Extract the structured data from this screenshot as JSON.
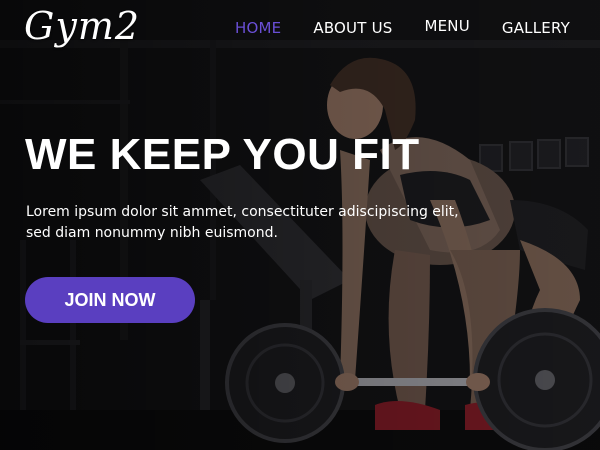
{
  "brand": {
    "logo_text": "Gym2"
  },
  "nav": {
    "items": [
      {
        "label": "HOME",
        "active": true
      },
      {
        "label": "ABOUT US",
        "active": false
      },
      {
        "label": "MENU",
        "active": false
      },
      {
        "label": "GALLERY",
        "active": false
      }
    ]
  },
  "hero": {
    "headline": "WE KEEP YOU FIT",
    "subtext": "Lorem ipsum dolor sit ammet, consectituter adiscipiscing elit, sed diam nonummy nibh euismond.",
    "cta_label": "JOIN NOW"
  },
  "colors": {
    "accent": "#5a3fc0",
    "nav_active": "#6a4fd6",
    "text": "#ffffff",
    "background": "#0e0e10"
  }
}
